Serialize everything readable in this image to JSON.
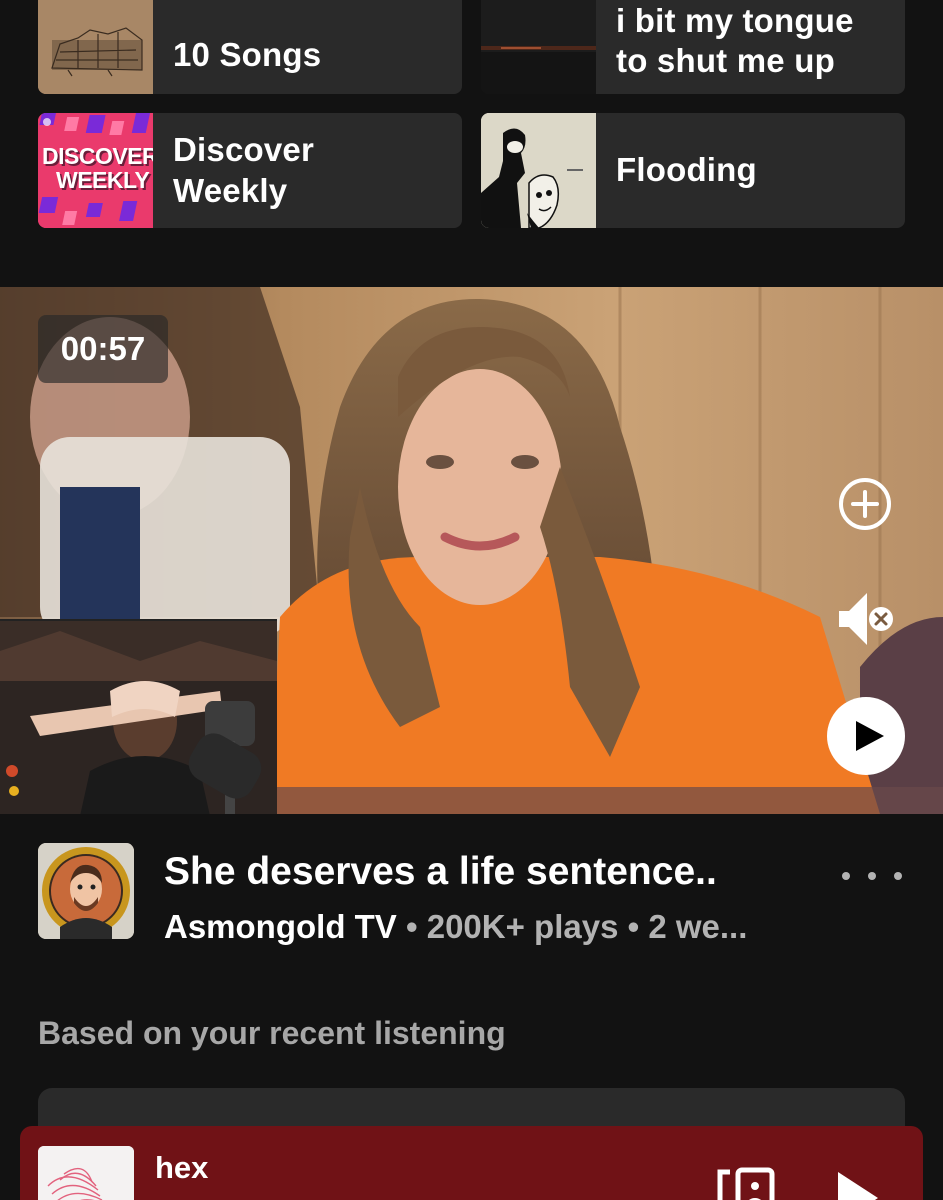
{
  "shortcuts": [
    {
      "label": "10 Songs"
    },
    {
      "label": "i bit my tongue to shut me up"
    },
    {
      "label": "Discover Weekly",
      "art_text_line1": "DISCOVER",
      "art_text_line2": "WEEKLY"
    },
    {
      "label": "Flooding"
    }
  ],
  "video": {
    "timestamp": "00:57",
    "title": "She deserves a life sentence..",
    "channel": "Asmongold TV",
    "meta_rest": " • 200K+ plays • 2 we..."
  },
  "section": {
    "title": "Based on your recent listening"
  },
  "mini_player": {
    "track_title": "hex"
  },
  "icons": {
    "add": "plus-circle-icon",
    "mute": "speaker-muted-icon",
    "play": "play-icon",
    "more": "more-dots-icon",
    "device": "connect-device-icon"
  },
  "colors": {
    "background": "#121212",
    "tile": "#2a2a2a",
    "mini_player": "#701216",
    "muted_text": "#b3b3b3"
  }
}
